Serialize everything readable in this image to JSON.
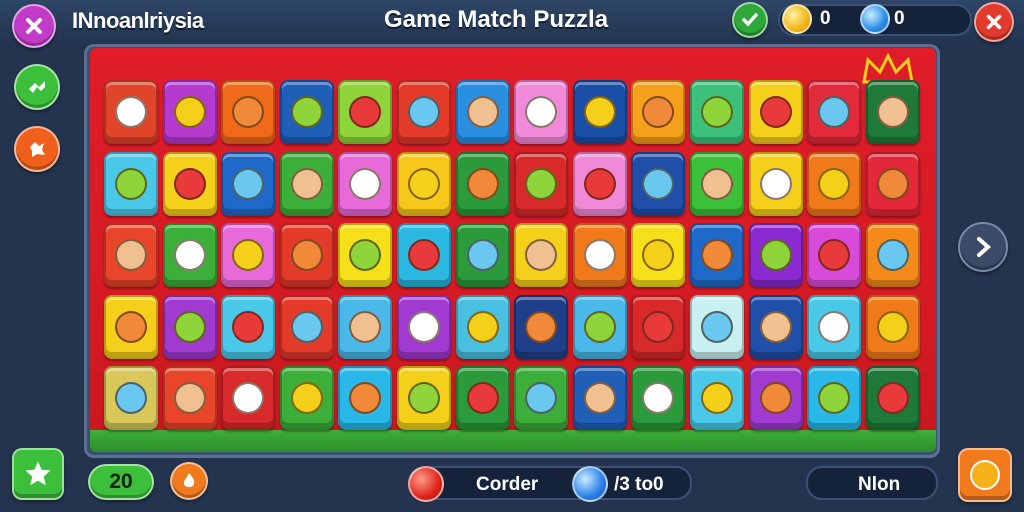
{
  "header": {
    "level_name": "INnoanlriysia",
    "title": "Game Match Puzzla",
    "gold_value": "0",
    "gem_value": "0"
  },
  "bottom": {
    "moves_value": "20",
    "order_label": "Corder",
    "progress_text": "/3 to0",
    "next_label": "Nlon"
  },
  "colors": {
    "close_red": "#e23b2e",
    "green_btn": "#3cbf3a",
    "orange_btn": "#f07a1c",
    "board_red": "#e01d28"
  },
  "icons": {
    "close": "close-icon",
    "check": "check-icon",
    "gold_coin": "gold-coin-icon",
    "blue_gem": "blue-gem-icon",
    "next_arrow": "chevron-right-icon",
    "star": "star-icon",
    "hint": "hint-icon",
    "shuffle": "shuffle-icon"
  },
  "board": {
    "rows": [
      [
        {
          "color": "#e0452a",
          "icon": "castle-icon"
        },
        {
          "color": "#b43ad0",
          "icon": "flower-icon"
        },
        {
          "color": "#f06a1a",
          "icon": "green-blob-icon"
        },
        {
          "color": "#1f5fb8",
          "icon": "bird-icon"
        },
        {
          "color": "#8ed43a",
          "icon": "orange-face-icon"
        },
        {
          "color": "#e33a2a",
          "icon": "tomato-icon"
        },
        {
          "color": "#2a8fe0",
          "icon": "yellow-chick-icon"
        },
        {
          "color": "#f08ad8",
          "icon": "lemon-icon"
        },
        {
          "color": "#1a4fa8",
          "icon": "ghost-icon"
        },
        {
          "color": "#f5a01a",
          "icon": "mango-icon"
        },
        {
          "color": "#3cc07a",
          "icon": "peach-face-icon"
        },
        {
          "color": "#f5d01a",
          "icon": "lion-icon"
        },
        {
          "color": "#e32a3a",
          "icon": "blue-orb-icon"
        },
        {
          "color": "#1f7a3a",
          "icon": "white-cat-icon"
        }
      ],
      [
        {
          "color": "#4ac8e8",
          "icon": "white-cat-icon"
        },
        {
          "color": "#f5d01a",
          "icon": "burger-icon"
        },
        {
          "color": "#1f6ac8",
          "icon": "yellow-bird-icon"
        },
        {
          "color": "#3cae3a",
          "icon": "egg-face-icon"
        },
        {
          "color": "#e86ad8",
          "icon": "pink-bug-icon"
        },
        {
          "color": "#f5c81a",
          "icon": "orange-shell-icon"
        },
        {
          "color": "#2a9a3a",
          "icon": "cloud-icon"
        },
        {
          "color": "#d82a2a",
          "icon": "castle-icon"
        },
        {
          "color": "#f08ad8",
          "icon": "yellow-kid-icon"
        },
        {
          "color": "#1f4fa8",
          "icon": "berry-icon"
        },
        {
          "color": "#3cc03a",
          "icon": "orange-cat-icon"
        },
        {
          "color": "#f5d01a",
          "icon": "palm-icon"
        },
        {
          "color": "#f07a1a",
          "icon": "blue-star-icon"
        },
        {
          "color": "#e3283a",
          "icon": "gem-icon"
        }
      ],
      [
        {
          "color": "#e8452a",
          "icon": "crayon-icon"
        },
        {
          "color": "#3cae3a",
          "icon": "snail-icon"
        },
        {
          "color": "#e86ad8",
          "icon": "red-tag-icon"
        },
        {
          "color": "#e33a2a",
          "icon": "pencil-icon"
        },
        {
          "color": "#f5e01a",
          "icon": "smile-face-icon"
        },
        {
          "color": "#2ab8e0",
          "icon": "water-drop-icon"
        },
        {
          "color": "#2a9a3a",
          "icon": "bunny-icon"
        },
        {
          "color": "#f5d01a",
          "icon": "goat-icon"
        },
        {
          "color": "#f07a1a",
          "icon": "orange-block-icon"
        },
        {
          "color": "#f5e01a",
          "icon": "egg-buddy-icon"
        },
        {
          "color": "#1f6ac8",
          "icon": "candy-icon"
        },
        {
          "color": "#8a2ad0",
          "icon": "blue-alien-icon"
        },
        {
          "color": "#d84ad8",
          "icon": "carrot-icon"
        },
        {
          "color": "#f58a1a",
          "icon": "eye-icon"
        }
      ],
      [
        {
          "color": "#f5d01a",
          "icon": "brown-face-icon"
        },
        {
          "color": "#a03ad0",
          "icon": "sun-face-icon"
        },
        {
          "color": "#4ac8e8",
          "icon": "egg-face-icon"
        },
        {
          "color": "#e33a2a",
          "icon": "fox-icon"
        },
        {
          "color": "#4ab8e8",
          "icon": "cap-kid-icon"
        },
        {
          "color": "#a03ad0",
          "icon": "snow-face-icon"
        },
        {
          "color": "#4ac0e0",
          "icon": "bear-icon"
        },
        {
          "color": "#1f3f8a",
          "icon": "bread-icon"
        },
        {
          "color": "#4ab8e8",
          "icon": "pear-icon"
        },
        {
          "color": "#d82a2a",
          "icon": "panda-icon"
        },
        {
          "color": "#c8f0f0",
          "icon": "lemon-icon"
        },
        {
          "color": "#1f4fa8",
          "icon": "statue-icon"
        },
        {
          "color": "#4ac8e8",
          "icon": "orange-block-icon"
        },
        {
          "color": "#f07a1a",
          "icon": "pink-ghost-icon"
        }
      ],
      [
        {
          "color": "#d8c85a",
          "icon": "castle-icon"
        },
        {
          "color": "#e8452a",
          "icon": "skull-icon"
        },
        {
          "color": "#d82a2a",
          "icon": "shell-icon"
        },
        {
          "color": "#3cae3a",
          "icon": "yellow-blob-icon"
        },
        {
          "color": "#2ab8e8",
          "icon": "chick-icon"
        },
        {
          "color": "#f5d01a",
          "icon": "orange-face-icon"
        },
        {
          "color": "#2a9a3a",
          "icon": "potato-icon"
        },
        {
          "color": "#3cae3a",
          "icon": "cheese-icon"
        },
        {
          "color": "#1f5fb8",
          "icon": "snowman-icon"
        },
        {
          "color": "#2a9a3a",
          "icon": "nut-face-icon"
        },
        {
          "color": "#4ac8e8",
          "icon": "orange-icon"
        },
        {
          "color": "#a03ad0",
          "icon": "potion-icon"
        },
        {
          "color": "#2ab8e8",
          "icon": "heart-icon"
        },
        {
          "color": "#1f7a3a",
          "icon": "white-cat-icon"
        }
      ]
    ]
  }
}
